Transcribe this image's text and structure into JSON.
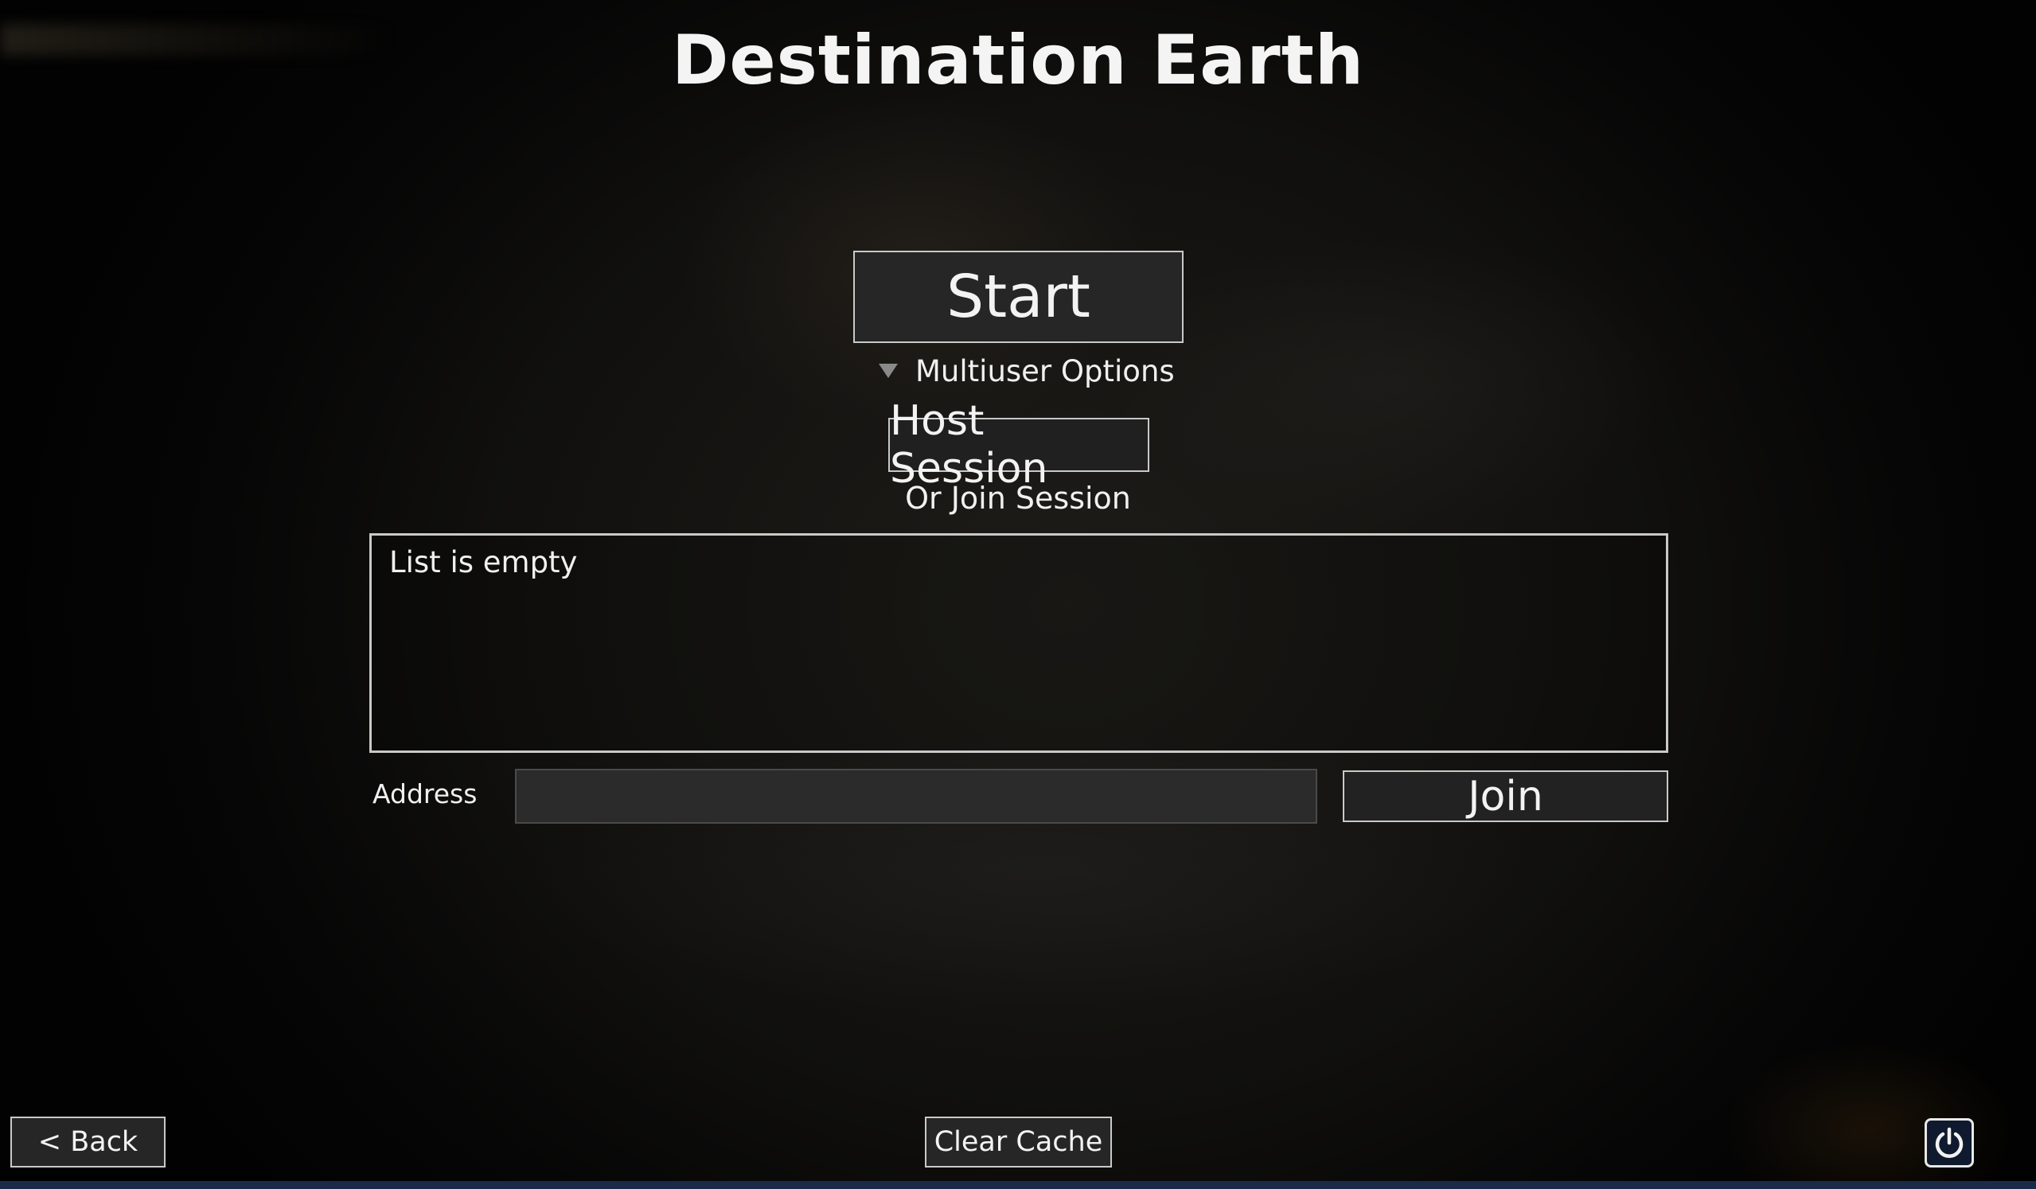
{
  "title": "Destination Earth",
  "buttons": {
    "start": "Start",
    "host_session": "Host Session",
    "join": "Join",
    "back": "< Back",
    "clear_cache": "Clear Cache"
  },
  "multiuser": {
    "toggle_label": "Multiuser Options",
    "or_join_label": "Or Join Session",
    "list_empty": "List is empty",
    "address_label": "Address",
    "address_value": ""
  },
  "icons": {
    "multiuser_toggle": "triangle-down-icon",
    "power": "power-icon"
  },
  "colors": {
    "button_bg": "#262626",
    "button_border": "#c9c9c9",
    "power_bg": "#0f1a2e",
    "bottom_strip": "#1c2a4a"
  }
}
